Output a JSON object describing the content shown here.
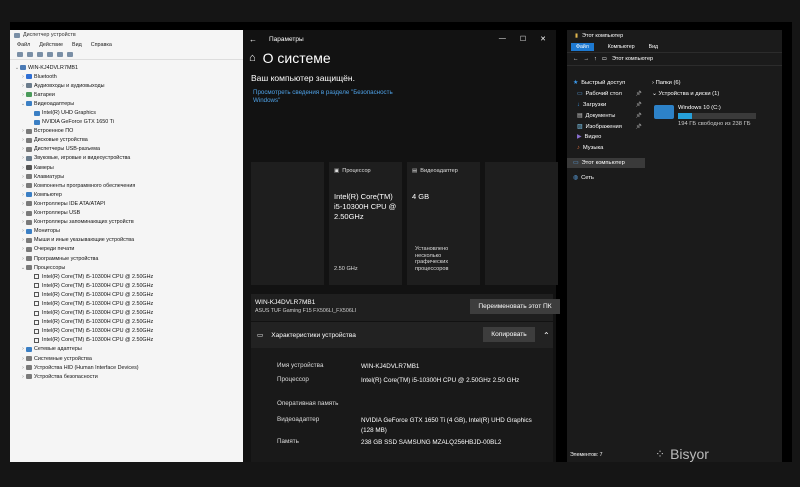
{
  "device_manager": {
    "title": "Диспетчер устройств",
    "menu": [
      "Файл",
      "Действие",
      "Вид",
      "Справка"
    ],
    "root": "WIN-KJ4DVLR7MB1",
    "items": [
      {
        "l": "Bluetooth",
        "c": "#2f6fd4"
      },
      {
        "l": "Аудиовходы и аудиовыходы",
        "c": "#6b7c8c"
      },
      {
        "l": "Батареи",
        "c": "#4a9a5a"
      },
      {
        "l": "Видеоадаптеры",
        "c": "#3b7fc4",
        "open": true
      },
      {
        "l": "Intel(R) UHD Graphics",
        "c": "#3b7fc4",
        "sub": true
      },
      {
        "l": "NVIDIA GeForce GTX 1650 Ti",
        "c": "#3b7fc4",
        "sub": true
      },
      {
        "l": "Встроенное ПО",
        "c": "#7a7a7a"
      },
      {
        "l": "Дисковые устройства",
        "c": "#7a7a7a"
      },
      {
        "l": "Диспетчеры USB-разъема",
        "c": "#7a7a7a"
      },
      {
        "l": "Звуковые, игровые и видеоустройства",
        "c": "#6b7c8c"
      },
      {
        "l": "Камеры",
        "c": "#555"
      },
      {
        "l": "Клавиатуры",
        "c": "#7a7a7a"
      },
      {
        "l": "Компоненты программного обеспечения",
        "c": "#7a7a7a"
      },
      {
        "l": "Компьютер",
        "c": "#3b7fc4"
      },
      {
        "l": "Контроллеры IDE ATA/ATAPI",
        "c": "#7a7a7a"
      },
      {
        "l": "Контроллеры USB",
        "c": "#7a7a7a"
      },
      {
        "l": "Контроллеры запоминающих устройств",
        "c": "#7a7a7a"
      },
      {
        "l": "Мониторы",
        "c": "#3b7fc4"
      },
      {
        "l": "Мыши и иные указывающие устройства",
        "c": "#7a7a7a"
      },
      {
        "l": "Очереди печати",
        "c": "#7a7a7a"
      },
      {
        "l": "Программные устройства",
        "c": "#7a7a7a"
      },
      {
        "l": "Процессоры",
        "c": "#7a7a7a",
        "open": true
      },
      {
        "l": "Intel(R) Core(TM) i5-10300H CPU @ 2.50GHz",
        "cpu": true
      },
      {
        "l": "Intel(R) Core(TM) i5-10300H CPU @ 2.50GHz",
        "cpu": true
      },
      {
        "l": "Intel(R) Core(TM) i5-10300H CPU @ 2.50GHz",
        "cpu": true
      },
      {
        "l": "Intel(R) Core(TM) i5-10300H CPU @ 2.50GHz",
        "cpu": true
      },
      {
        "l": "Intel(R) Core(TM) i5-10300H CPU @ 2.50GHz",
        "cpu": true
      },
      {
        "l": "Intel(R) Core(TM) i5-10300H CPU @ 2.50GHz",
        "cpu": true
      },
      {
        "l": "Intel(R) Core(TM) i5-10300H CPU @ 2.50GHz",
        "cpu": true
      },
      {
        "l": "Intel(R) Core(TM) i5-10300H CPU @ 2.50GHz",
        "cpu": true
      },
      {
        "l": "Сетевые адаптеры",
        "c": "#3b7fc4"
      },
      {
        "l": "Системные устройства",
        "c": "#7a7a7a"
      },
      {
        "l": "Устройства HID (Human Interface Devices)",
        "c": "#7a7a7a"
      },
      {
        "l": "Устройства безопасности",
        "c": "#7a7a7a"
      }
    ]
  },
  "settings": {
    "window_title": "Параметры",
    "page_title": "О системе",
    "protected": "Ваш компьютер защищён.",
    "security_link": "Просмотреть сведения в разделе \"Безопасность Windows\"",
    "cpu_card": {
      "label": "Процессор",
      "value": "Intel(R) Core(TM) i5-10300H CPU @ 2.50GHz",
      "speed": "2.50 GHz"
    },
    "gpu_card": {
      "label": "Видеоадаптер",
      "value": "4 GB",
      "desc": "Установлено несколько графических процессоров"
    },
    "pc_name": "WIN-KJ4DVLR7MB1",
    "pc_model": "ASUS TUF Gaming F15 FX506LI_FX506LI",
    "rename_btn": "Переименовать этот ПК",
    "specs_title": "Характеристики устройства",
    "copy_btn": "Копировать",
    "specs": [
      {
        "k": "Имя устройства",
        "v": "WIN-KJ4DVLR7MB1"
      },
      {
        "k": "Процессор",
        "v": "Intel(R) Core(TM) i5-10300H CPU @ 2.50GHz 2.50 GHz"
      },
      {
        "k": "Оперативная память",
        "v": ""
      },
      {
        "k": "Видеоадаптер",
        "v": "NVIDIA GeForce GTX 1650 Ti (4 GB), Intel(R) UHD Graphics (128 MB)"
      },
      {
        "k": "Память",
        "v": "238 GB SSD SAMSUNG MZALQ256HBJD-00BL2"
      }
    ]
  },
  "explorer": {
    "window_title": "Этот компьютер",
    "ribbon": [
      "Файл",
      "Компьютер",
      "Вид"
    ],
    "address": "Этот компьютер",
    "nav": [
      {
        "l": "Быстрый доступ",
        "pin": false
      },
      {
        "l": "Рабочий стол",
        "pin": true
      },
      {
        "l": "Загрузки",
        "pin": true
      },
      {
        "l": "Документы",
        "pin": true
      },
      {
        "l": "Изображения",
        "pin": true
      },
      {
        "l": "Видео",
        "pin": false
      },
      {
        "l": "Музыка",
        "pin": false
      },
      {
        "l": "Этот компьютер",
        "pin": false
      },
      {
        "l": "Сеть",
        "pin": false
      }
    ],
    "folders_group": "Папки (6)",
    "drives_group": "Устройства и диски (1)",
    "drive_name": "Windows 10 (C:)",
    "drive_free": "194 ГБ свободно из 238 ГБ",
    "drive_used_fraction": 0.185,
    "status": "Элементов: 7"
  },
  "watermark": "Bisyor"
}
